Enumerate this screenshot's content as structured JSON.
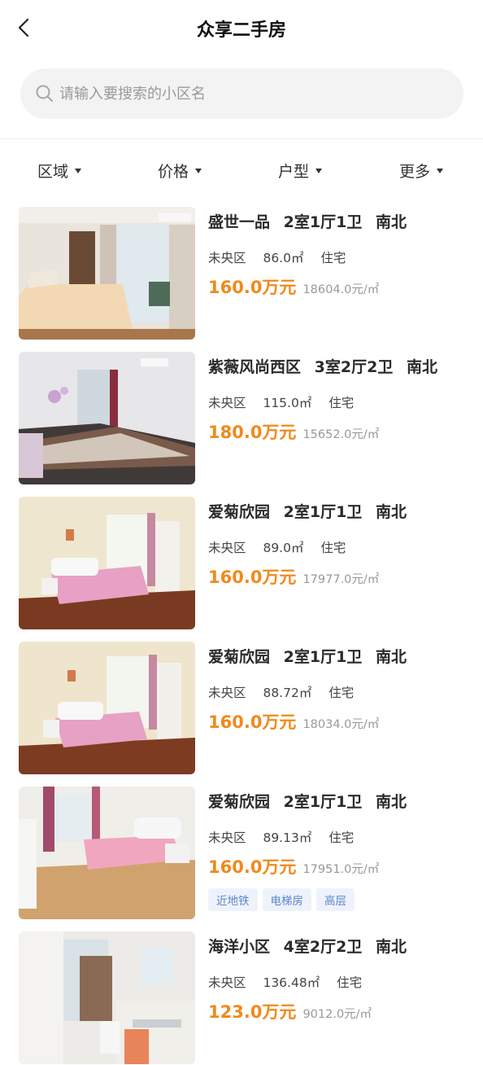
{
  "header": {
    "title": "众享二手房"
  },
  "search": {
    "placeholder": "请输入要搜索的小区名"
  },
  "filters": [
    {
      "label": "区域"
    },
    {
      "label": "价格"
    },
    {
      "label": "户型"
    },
    {
      "label": "更多"
    }
  ],
  "listings": [
    {
      "name": "盛世一品",
      "layout": "2室1厅1卫",
      "orientation": "南北",
      "district": "未央区",
      "area": "86.0㎡",
      "type": "住宅",
      "price": "160.0万元",
      "unit_price": "18604.0元/㎡",
      "tags": []
    },
    {
      "name": "紫薇风尚西区",
      "layout": "3室2厅2卫",
      "orientation": "南北",
      "district": "未央区",
      "area": "115.0㎡",
      "type": "住宅",
      "price": "180.0万元",
      "unit_price": "15652.0元/㎡",
      "tags": []
    },
    {
      "name": "爱菊欣园",
      "layout": "2室1厅1卫",
      "orientation": "南北",
      "district": "未央区",
      "area": "89.0㎡",
      "type": "住宅",
      "price": "160.0万元",
      "unit_price": "17977.0元/㎡",
      "tags": []
    },
    {
      "name": "爱菊欣园",
      "layout": "2室1厅1卫",
      "orientation": "南北",
      "district": "未央区",
      "area": "88.72㎡",
      "type": "住宅",
      "price": "160.0万元",
      "unit_price": "18034.0元/㎡",
      "tags": []
    },
    {
      "name": "爱菊欣园",
      "layout": "2室1厅1卫",
      "orientation": "南北",
      "district": "未央区",
      "area": "89.13㎡",
      "type": "住宅",
      "price": "160.0万元",
      "unit_price": "17951.0元/㎡",
      "tags": [
        "近地铁",
        "电梯房",
        "高层"
      ]
    },
    {
      "name": "海洋小区",
      "layout": "4室2厅2卫",
      "orientation": "南北",
      "district": "未央区",
      "area": "136.48㎡",
      "type": "住宅",
      "price": "123.0万元",
      "unit_price": "9012.0元/㎡",
      "tags": []
    }
  ],
  "colors": {
    "price": "#f08a1c",
    "tag_text": "#5a86c8",
    "tag_bg": "#eef3fb"
  }
}
